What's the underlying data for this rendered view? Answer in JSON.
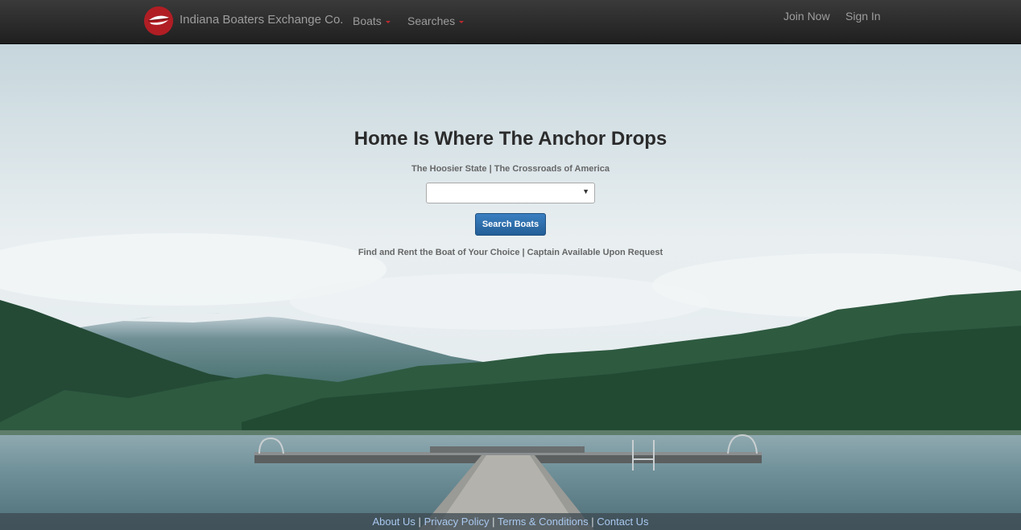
{
  "navbar": {
    "brand_name": "Indiana Boaters Exchange Co.",
    "menu": [
      {
        "label": "Boats"
      },
      {
        "label": "Searches"
      }
    ],
    "join_label": "Join Now",
    "signin_label": "Sign In"
  },
  "hero": {
    "title": "Home Is Where The Anchor Drops",
    "subtitle": "The Hoosier State | The Crossroads of America",
    "select_value": "",
    "search_button": "Search Boats",
    "tagline": "Find and Rent the Boat of Your Choice | Captain Available Upon Request"
  },
  "footer": {
    "links": [
      "About Us",
      "Privacy Policy",
      "Terms & Conditions",
      "Contact Us"
    ],
    "separator": "|"
  },
  "colors": {
    "navbar_bg": "#2a2a2a",
    "brand_red": "#b01e24",
    "button_blue": "#2e6da4",
    "footer_link": "#a9c8ef"
  },
  "icons": {
    "logo": "boat-logo-icon",
    "dropdown": "caret-down-icon",
    "select": "chevron-down-icon"
  }
}
